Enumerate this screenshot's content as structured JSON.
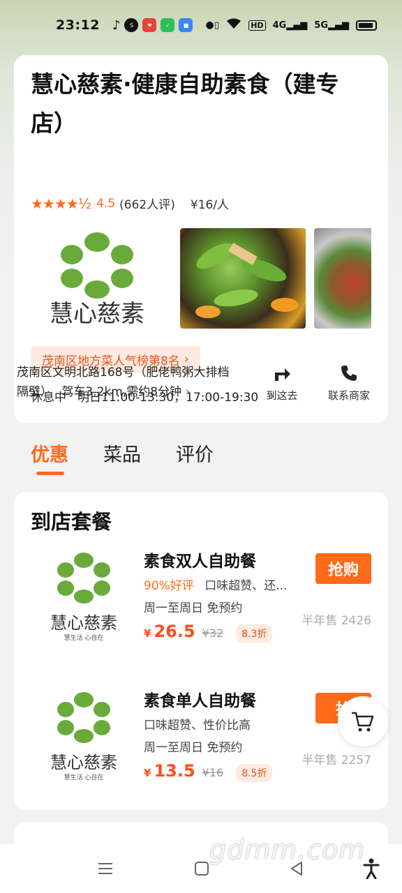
{
  "status_bar": {
    "time": "23:12",
    "icons": [
      "music-note-icon",
      "soul-app-icon",
      "red-app-icon",
      "green-app-icon",
      "blue-app-icon"
    ],
    "network": [
      "vibrate-icon",
      "wifi-icon",
      "HD",
      "4G",
      "5G",
      "battery-icon"
    ],
    "labels": {
      "hd": "HD",
      "g4": "4G",
      "g5": "5G"
    }
  },
  "shop": {
    "title": "慧心慈素·健康自助素食（建专店）",
    "rating_stars": "★★★★½",
    "rating": "4.5",
    "review_count": "(662人评)",
    "price_per_person": "¥16/人",
    "rank": "茂南区地方菜人气榜第8名",
    "status": "休息中",
    "hours": "明日11:00-13:30，17:00-19:30",
    "address": "茂南区文明北路168号（肥佬鸭粥大排档隔壁）",
    "distance": "驾车3.2km,需约8分钟",
    "actions": {
      "navigate": "到这去",
      "contact": "联系商家"
    },
    "logo_text": "慧心慈素"
  },
  "tabs": [
    {
      "label": "优惠",
      "active": true
    },
    {
      "label": "菜品",
      "active": false
    },
    {
      "label": "评价",
      "active": false
    }
  ],
  "deals": {
    "section_title": "到店套餐",
    "items": [
      {
        "name": "素食双人自助餐",
        "good_rate": "90%好评",
        "tags": "口味超赞、还...",
        "availability": "周一至周日  免预约",
        "currency": "¥",
        "price": "26.5",
        "old_price": "¥32",
        "discount": "8.3折",
        "buy_label": "抢购",
        "sold": "半年售 2426",
        "logo_text": "慧心慈素",
        "logo_sub": "慧生活  心自在"
      },
      {
        "name": "素食单人自助餐",
        "good_rate": "",
        "tags": "口味超赞、性价比高",
        "availability": "周一至周日  免预约",
        "currency": "¥",
        "price": "13.5",
        "old_price": "¥16",
        "discount": "8.5折",
        "buy_label": "抢",
        "sold": "半年售 2257",
        "logo_text": "慧心慈素",
        "logo_sub": "慧生活  心自在"
      }
    ]
  },
  "watermark": "gdmm.com",
  "colors": {
    "accent": "#ff6a1a",
    "price": "#ff4d1a",
    "badge_bg": "#fdebe2",
    "logo_green": "#6aaa3a"
  }
}
